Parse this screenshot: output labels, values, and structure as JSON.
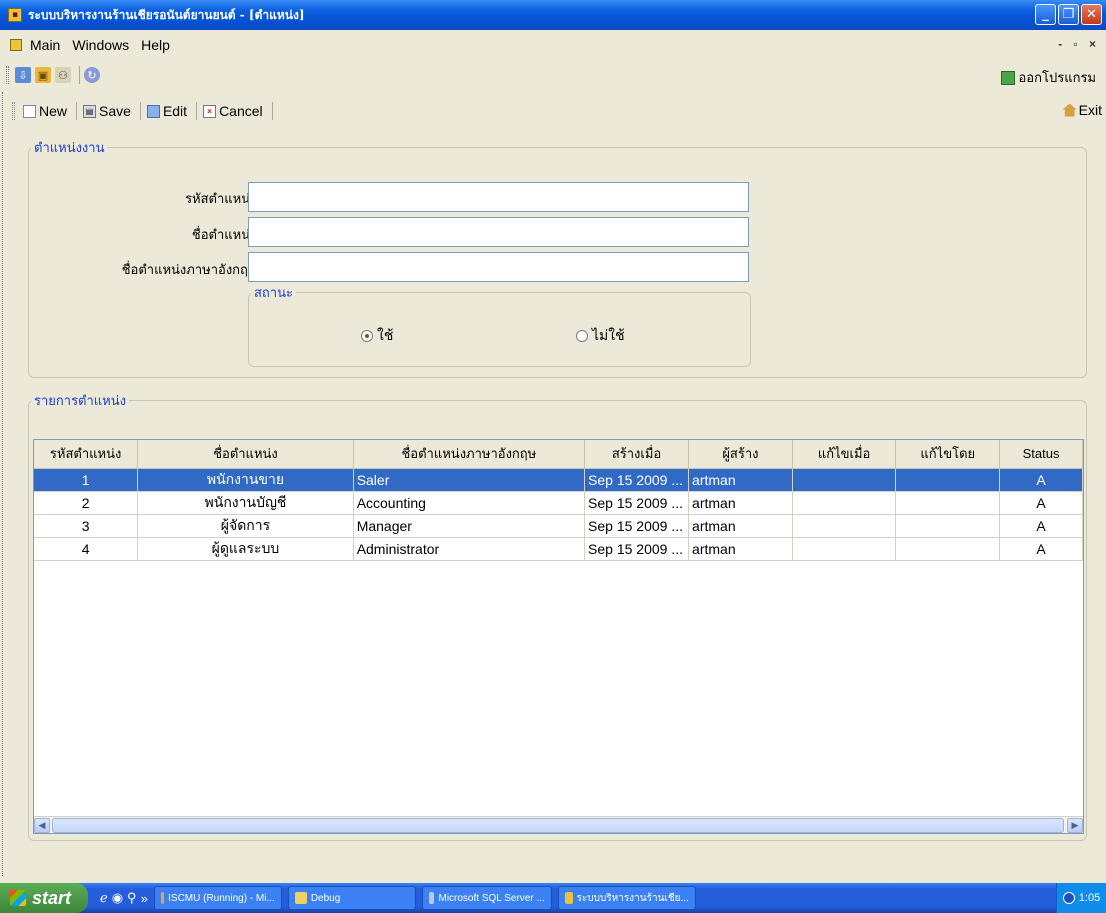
{
  "window": {
    "title": "ระบบบริหารงานร้านเชียรอนันต์ยานยนต์ - [ตำแหน่ง]"
  },
  "menu": {
    "items": [
      "Main",
      "Windows",
      "Help"
    ]
  },
  "icon_toolbar": {
    "logout_label": "ออกโปรแกรม"
  },
  "actions": {
    "new": "New",
    "save": "Save",
    "edit": "Edit",
    "cancel": "Cancel",
    "exit": "Exit"
  },
  "form": {
    "legend": "ตำแหน่งงาน",
    "code_label": "รหัสตำแหน่ง :",
    "code_value": "",
    "name_label": "ชื่อตำแหน่ง :",
    "name_value": "",
    "name_en_label": "ชื่อตำแหน่งภาษาอังกฤษ :",
    "name_en_value": "",
    "status": {
      "legend": "สถานะ",
      "option_active": "ใช้",
      "option_inactive": "ไม่ใช้",
      "selected": "ใช้"
    }
  },
  "list": {
    "legend": "รายการตำแหน่ง",
    "columns": [
      "รหัสตำแหน่ง",
      "ชื่อตำแหน่ง",
      "ชื่อตำแหน่งภาษาอังกฤษ",
      "สร้างเมื่อ",
      "ผู้สร้าง",
      "แก้ไขเมื่อ",
      "แก้ไขโดย",
      "Status"
    ],
    "rows": [
      {
        "code": "1",
        "name": "พนักงานขาย",
        "name_en": "Saler",
        "created": "Sep 15 2009 ...",
        "creator": "artman",
        "edited": "",
        "editor": "",
        "status": "A"
      },
      {
        "code": "2",
        "name": "พนักงานบัญชี",
        "name_en": "Accounting",
        "created": "Sep 15 2009 ...",
        "creator": "artman",
        "edited": "",
        "editor": "",
        "status": "A"
      },
      {
        "code": "3",
        "name": "ผู้จัดการ",
        "name_en": "Manager",
        "created": "Sep 15 2009 ...",
        "creator": "artman",
        "edited": "",
        "editor": "",
        "status": "A"
      },
      {
        "code": "4",
        "name": "ผู้ดูแลระบบ",
        "name_en": "Administrator",
        "created": "Sep 15 2009 ...",
        "creator": "artman",
        "edited": "",
        "editor": "",
        "status": "A"
      }
    ],
    "selected_row": 0
  },
  "taskbar": {
    "start": "start",
    "tasks": [
      "ISCMU (Running) - Mi...",
      "Debug",
      "Microsoft SQL Server ...",
      "ระบบบริหารงานร้านเชีย..."
    ],
    "clock": "1:05"
  },
  "colors": {
    "selection": "#316ac5",
    "legend_text": "#1a3fd0",
    "title_bar": "#0552d3"
  }
}
